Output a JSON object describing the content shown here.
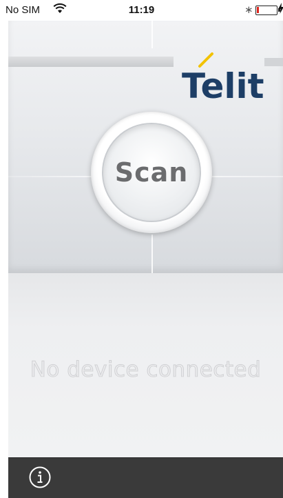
{
  "status_bar": {
    "carrier": "No SIM",
    "time": "11:19",
    "bluetooth_symbol": "∗",
    "battery_level_percent": 10
  },
  "header": {
    "logo_text": "Telit",
    "logo_color": "#1d3e66",
    "logo_accent_color": "#f2c200"
  },
  "main": {
    "scan_button_label": "Scan",
    "connection_status": "No device connected"
  },
  "toolbar": {
    "info_icon": "info-icon",
    "background_color": "#3a3a3a"
  }
}
